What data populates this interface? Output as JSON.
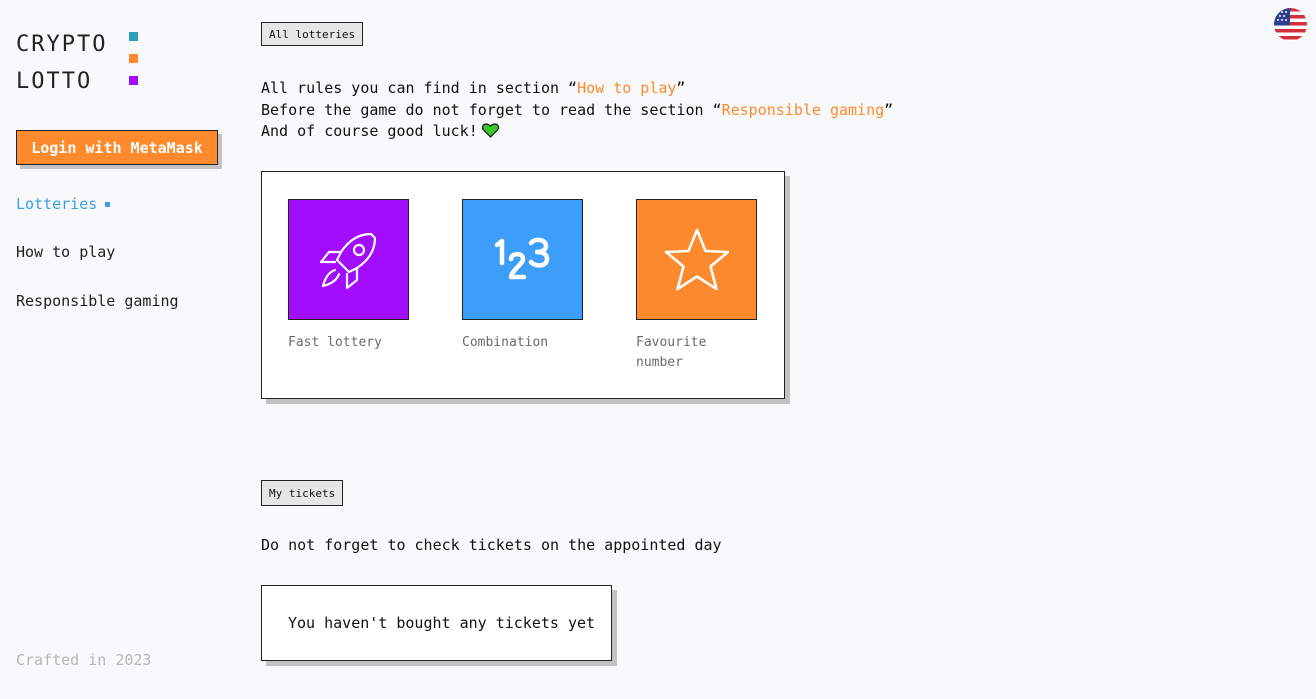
{
  "logo": {
    "line1": "CRYPTO",
    "line2": "LOTTO",
    "dot_colors": [
      "#2a9fbc",
      "#ff8a2e",
      "#a20cff"
    ]
  },
  "sidebar": {
    "login_label": "Login with MetaMask",
    "nav": [
      {
        "label": "Lotteries",
        "active": true
      },
      {
        "label": "How to play",
        "active": false
      },
      {
        "label": "Responsible gaming",
        "active": false
      }
    ],
    "footer": "Crafted in 2023"
  },
  "language": {
    "icon": "us-flag-icon"
  },
  "lotteries": {
    "tag": "All lotteries",
    "intro": {
      "line1_prefix": "All rules you can find in section “",
      "line1_link": "How to play",
      "line1_suffix": "”",
      "line2_prefix": "Before the game do not forget to read the section “",
      "line2_link": "Responsible gaming",
      "line2_suffix": "”",
      "line3": "And of course good luck!",
      "line3_icon": "green-heart-icon"
    },
    "cards": [
      {
        "name": "Fast lottery",
        "icon": "rocket-icon",
        "color": "#a20cff"
      },
      {
        "name": "Combination",
        "icon": "numbers-123-icon",
        "color": "#3c9ef8"
      },
      {
        "name": "Favourite number",
        "icon": "star-icon",
        "color": "#ff8a2e"
      }
    ]
  },
  "tickets": {
    "tag": "My tickets",
    "hint": "Do not forget to check tickets on the appointed day",
    "empty": "You haven't bought any tickets yet"
  },
  "colors": {
    "accent": "#ff8a2e",
    "active_nav": "#3aa0e8",
    "muted": "#b6b6b6"
  }
}
